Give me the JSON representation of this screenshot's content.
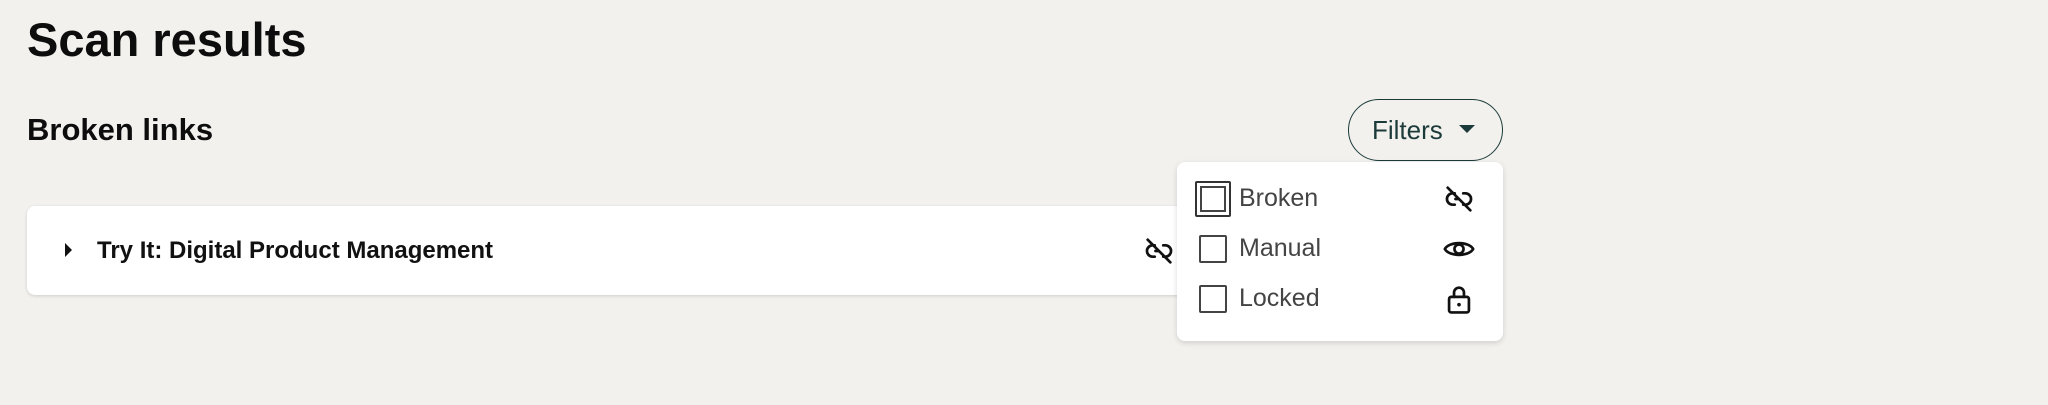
{
  "page": {
    "title": "Scan results"
  },
  "section": {
    "title": "Broken links"
  },
  "filters": {
    "button_label": "Filters",
    "options": [
      {
        "label": "Broken",
        "icon": "broken-link-icon",
        "checked": false,
        "focused": true
      },
      {
        "label": "Manual",
        "icon": "eye-icon",
        "checked": false,
        "focused": false
      },
      {
        "label": "Locked",
        "icon": "lock-icon",
        "checked": false,
        "focused": false
      }
    ]
  },
  "results": [
    {
      "title": "Try It: Digital Product Management",
      "status_icon": "broken-link-icon"
    }
  ],
  "colors": {
    "background": "#f2f1ee",
    "button_border": "#1c3a3a",
    "text_primary": "#111111",
    "text_option": "#444444"
  }
}
